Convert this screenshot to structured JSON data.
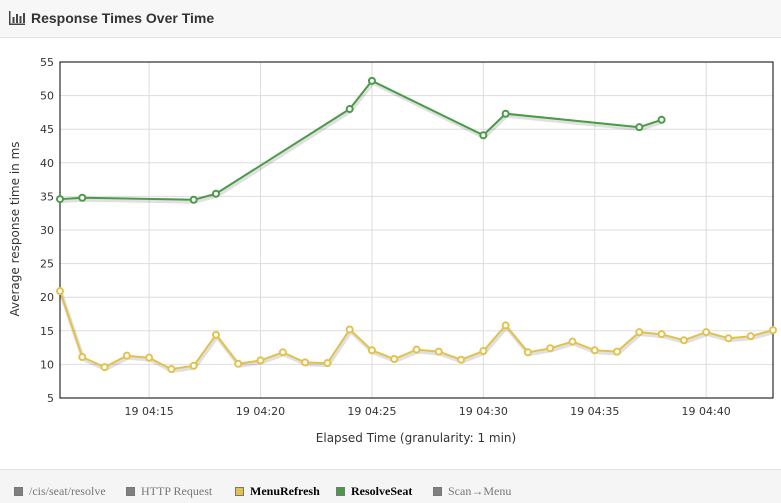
{
  "header": {
    "title": "Response Times Over Time",
    "icon": "bar-chart-icon"
  },
  "colors": {
    "resolve_seat": "#4a9b47",
    "menu_refresh": "#e2c24c",
    "disabled": "#808080",
    "grid": "#dddddd"
  },
  "chart_data": {
    "type": "line",
    "xlabel": "Elapsed Time (granularity: 1 min)",
    "ylabel": "Average response time in ms",
    "ylim": [
      5,
      55
    ],
    "yticks": [
      5,
      10,
      15,
      20,
      25,
      30,
      35,
      40,
      45,
      50,
      55
    ],
    "xlim": [
      "19 04:11",
      "19 04:43"
    ],
    "xtick_labels": [
      "19 04:15",
      "19 04:20",
      "19 04:25",
      "19 04:30",
      "19 04:35",
      "19 04:40"
    ],
    "grid": true,
    "series": [
      {
        "name": "ResolveSeat",
        "color": "#4a9b47",
        "x": [
          "19 04:11",
          "19 04:12",
          "19 04:17",
          "19 04:18",
          "19 04:24",
          "19 04:25",
          "19 04:30",
          "19 04:31",
          "19 04:37",
          "19 04:38"
        ],
        "y": [
          34.6,
          34.8,
          34.5,
          35.4,
          48.0,
          52.2,
          44.1,
          47.3,
          45.3,
          46.4
        ]
      },
      {
        "name": "MenuRefresh",
        "color": "#e2c24c",
        "x": [
          "19 04:11",
          "19 04:12",
          "19 04:13",
          "19 04:14",
          "19 04:15",
          "19 04:16",
          "19 04:17",
          "19 04:18",
          "19 04:19",
          "19 04:20",
          "19 04:21",
          "19 04:22",
          "19 04:23",
          "19 04:24",
          "19 04:25",
          "19 04:26",
          "19 04:27",
          "19 04:28",
          "19 04:29",
          "19 04:30",
          "19 04:31",
          "19 04:32",
          "19 04:33",
          "19 04:34",
          "19 04:35",
          "19 04:36",
          "19 04:37",
          "19 04:38",
          "19 04:39",
          "19 04:40",
          "19 04:41",
          "19 04:42",
          "19 04:43"
        ],
        "y": [
          20.9,
          11.1,
          9.6,
          11.3,
          11.0,
          9.3,
          9.8,
          14.4,
          10.1,
          10.6,
          11.8,
          10.3,
          10.2,
          15.2,
          12.1,
          10.8,
          12.2,
          11.9,
          10.7,
          12.0,
          15.8,
          11.8,
          12.4,
          13.4,
          12.1,
          11.9,
          14.8,
          14.5,
          13.6,
          14.8,
          13.9,
          14.2,
          15.1
        ]
      }
    ]
  },
  "legend": [
    {
      "label": "/cis/seat/resolve",
      "color": "#808080",
      "enabled": false
    },
    {
      "label": "HTTP Request",
      "color": "#808080",
      "enabled": false
    },
    {
      "label": "MenuRefresh",
      "color": "#e2c24c",
      "enabled": true
    },
    {
      "label": "ResolveSeat",
      "color": "#4a9b47",
      "enabled": true
    },
    {
      "label": "Scan→Menu",
      "color": "#808080",
      "enabled": false
    }
  ]
}
